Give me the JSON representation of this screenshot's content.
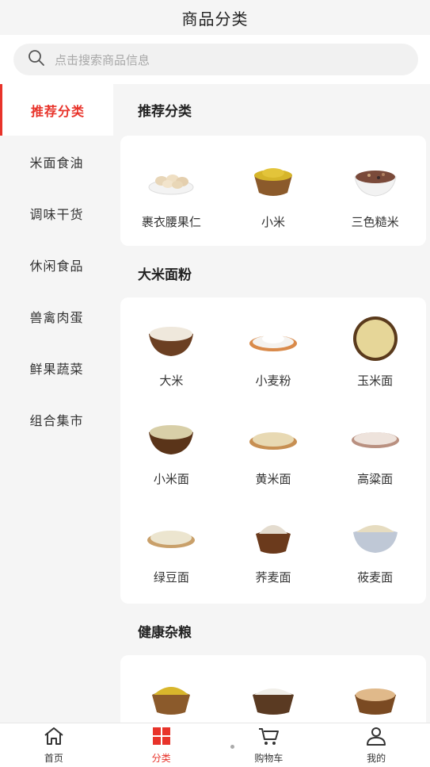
{
  "header": {
    "title": "商品分类"
  },
  "search": {
    "placeholder": "点击搜索商品信息",
    "icon": "search-icon"
  },
  "sidebar": {
    "items": [
      {
        "label": "推荐分类",
        "active": true
      },
      {
        "label": "米面食油"
      },
      {
        "label": "调味干货"
      },
      {
        "label": "休闲食品"
      },
      {
        "label": "兽禽肉蛋"
      },
      {
        "label": "鲜果蔬菜"
      },
      {
        "label": "组合集市"
      }
    ]
  },
  "sections": [
    {
      "title": "推荐分类",
      "items": [
        "裹衣腰果仁",
        "小米",
        "三色糙米"
      ]
    },
    {
      "title": "大米面粉",
      "items": [
        "大米",
        "小麦粉",
        "玉米面",
        "小米面",
        "黄米面",
        "高粱面",
        "绿豆面",
        "荞麦面",
        "莜麦面"
      ]
    },
    {
      "title": "健康杂粮",
      "items": [
        "",
        "",
        ""
      ]
    }
  ],
  "tabbar": {
    "items": [
      {
        "label": "首页",
        "icon": "home-icon"
      },
      {
        "label": "分类",
        "icon": "category-icon",
        "active": true
      },
      {
        "label": "购物车",
        "icon": "cart-icon"
      },
      {
        "label": "我的",
        "icon": "user-icon"
      }
    ]
  },
  "colors": {
    "accent": "#e8332a",
    "background": "#f5f5f5",
    "card": "#ffffff"
  }
}
